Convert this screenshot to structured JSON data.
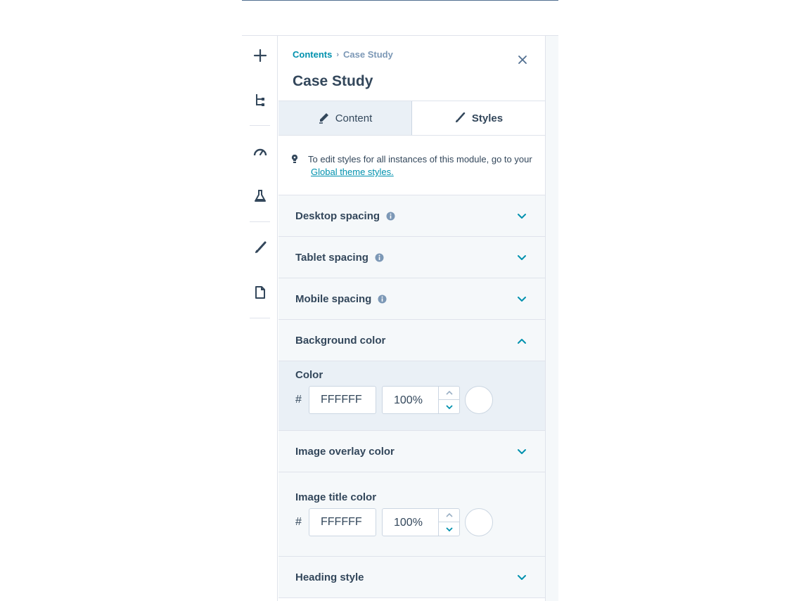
{
  "breadcrumb": {
    "parent": "Contents",
    "current": "Case Study"
  },
  "panel": {
    "title": "Case Study"
  },
  "tabs": [
    {
      "label": "Content",
      "active": false
    },
    {
      "label": "Styles",
      "active": true
    }
  ],
  "notice": {
    "text": "To edit styles for all instances of this module, go to your",
    "link": "Global theme styles."
  },
  "sections": {
    "desktop_spacing": "Desktop spacing",
    "tablet_spacing": "Tablet spacing",
    "mobile_spacing": "Mobile spacing",
    "background_color": "Background color",
    "image_overlay_color": "Image overlay color",
    "image_title_color": "Image title color",
    "heading_style": "Heading style"
  },
  "background_color": {
    "field_label": "Color",
    "hash": "#",
    "hex": "FFFFFF",
    "opacity": "100%",
    "swatch": "#FFFFFF"
  },
  "image_title_color": {
    "hash": "#",
    "hex": "FFFFFF",
    "opacity": "100%",
    "swatch": "#FFFFFF"
  },
  "colors": {
    "accent": "#0091ae",
    "text": "#33475b",
    "border": "#dfe3eb"
  },
  "icons": [
    "add-icon",
    "tree-icon",
    "gauge-icon",
    "flask-icon",
    "brush-icon",
    "page-icon",
    "close-icon",
    "pencil-icon",
    "brush-icon",
    "bulb-icon",
    "info-icon",
    "chevron-down-icon",
    "chevron-up-icon"
  ]
}
